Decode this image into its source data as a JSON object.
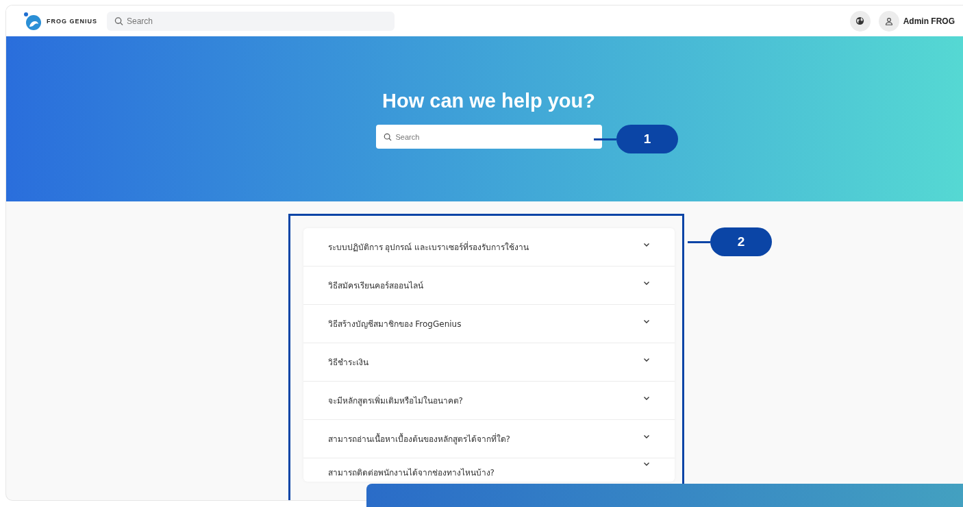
{
  "header": {
    "logo_text": "FROG GENIUS",
    "search": {
      "placeholder": "Search"
    },
    "user_name": "Admin FROG"
  },
  "hero": {
    "title": "How can we help you?",
    "search": {
      "placeholder": "Search"
    }
  },
  "faq": {
    "items": [
      {
        "question": "ระบบปฏิบัติการ อุปกรณ์ และเบราเซอร์ที่รองรับการใช้งาน",
        "expanded": false
      },
      {
        "question": "วิธีสมัครเรียนคอร์สออนไลน์",
        "expanded": false
      },
      {
        "question": "วิธีสร้างบัญชีสมาชิกของ FrogGenius",
        "expanded": false
      },
      {
        "question": "วิธีชำระเงิน",
        "expanded": false
      },
      {
        "question": "จะมีหลักสูตรเพิ่มเติมหรือไม่ในอนาคต?",
        "expanded": false
      },
      {
        "question": "สามารถอ่านเนื้อหาเบื้องต้นของหลักสูตรได้จากที่ใด?",
        "expanded": false
      },
      {
        "question": "สามารถติดต่อพนักงานได้จากช่องทางไหนบ้าง?",
        "expanded": false
      }
    ]
  },
  "callouts": [
    {
      "label": "1"
    },
    {
      "label": "2"
    }
  ]
}
